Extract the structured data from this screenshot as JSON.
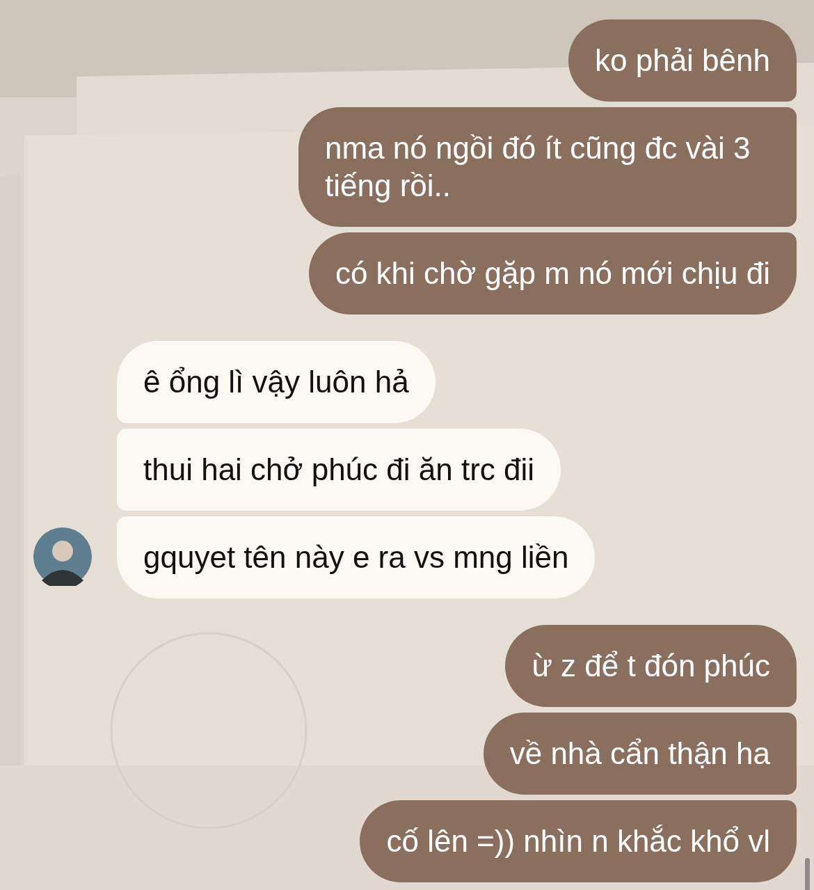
{
  "groups": [
    {
      "kind": "sent",
      "messages": [
        "ko phải bênh",
        "nma nó ngồi đó ít cũng đc vài 3 tiếng rồi..",
        "có khi chờ gặp m nó mới chịu đi"
      ]
    },
    {
      "kind": "received",
      "messages": [
        "ê ổng lì vậy luôn hả",
        "thui hai chở phúc đi ăn trc đii",
        "gquyet tên này e ra vs mng liền"
      ]
    },
    {
      "kind": "sent",
      "messages": [
        "ừ z để t đón phúc",
        "về nhà cẩn thận ha",
        "cố lên =)) nhìn n khắc khổ vl"
      ]
    }
  ]
}
